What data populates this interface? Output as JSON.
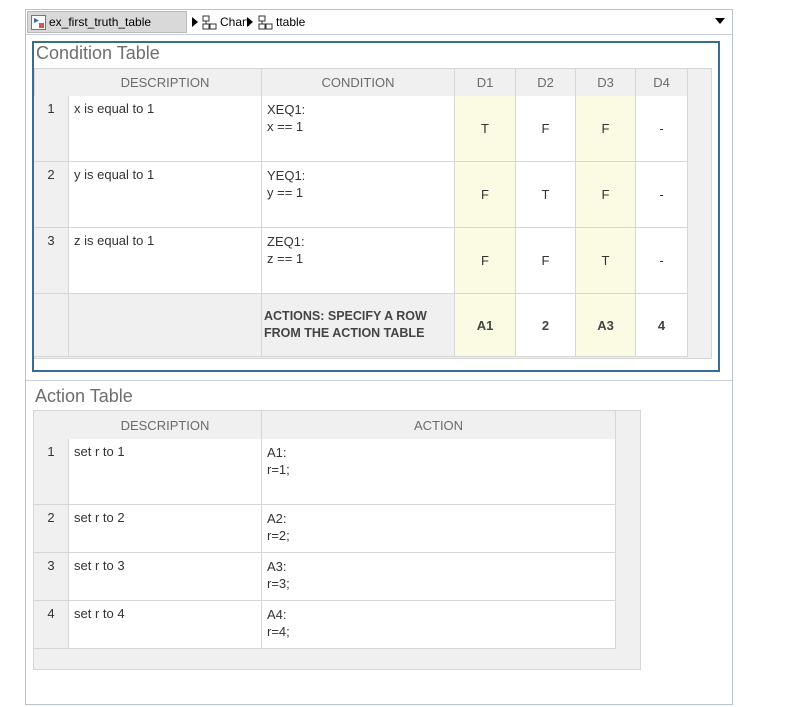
{
  "breadcrumb": {
    "items": [
      "ex_first_truth_table",
      "Chart",
      "ttable"
    ]
  },
  "condition_table": {
    "title": "Condition Table",
    "headers": {
      "description": "DESCRIPTION",
      "condition": "CONDITION",
      "d1": "D1",
      "d2": "D2",
      "d3": "D3",
      "d4": "D4"
    },
    "rows": [
      {
        "num": "1",
        "description": "x is equal to 1",
        "condition": "XEQ1:\nx == 1",
        "d": [
          "T",
          "F",
          "F",
          "-"
        ]
      },
      {
        "num": "2",
        "description": "y is equal to 1",
        "condition": "YEQ1:\ny == 1",
        "d": [
          "F",
          "T",
          "F",
          "-"
        ]
      },
      {
        "num": "3",
        "description": "z is equal to 1",
        "condition": "ZEQ1:\nz == 1",
        "d": [
          "F",
          "F",
          "T",
          "-"
        ]
      }
    ],
    "actions_row": {
      "label": "ACTIONS: SPECIFY A ROW\nFROM THE ACTION TABLE",
      "d": [
        "A1",
        "2",
        "A3",
        "4"
      ]
    }
  },
  "action_table": {
    "title": "Action Table",
    "headers": {
      "description": "DESCRIPTION",
      "action": "ACTION"
    },
    "rows": [
      {
        "num": "1",
        "description": "set r to 1",
        "action": "A1:\nr=1;"
      },
      {
        "num": "2",
        "description": "set r to 2",
        "action": "A2:\nr=2;"
      },
      {
        "num": "3",
        "description": "set r to 3",
        "action": "A3:\nr=3;"
      },
      {
        "num": "4",
        "description": "set r to 4",
        "action": "A4:\nr=4;"
      }
    ]
  }
}
